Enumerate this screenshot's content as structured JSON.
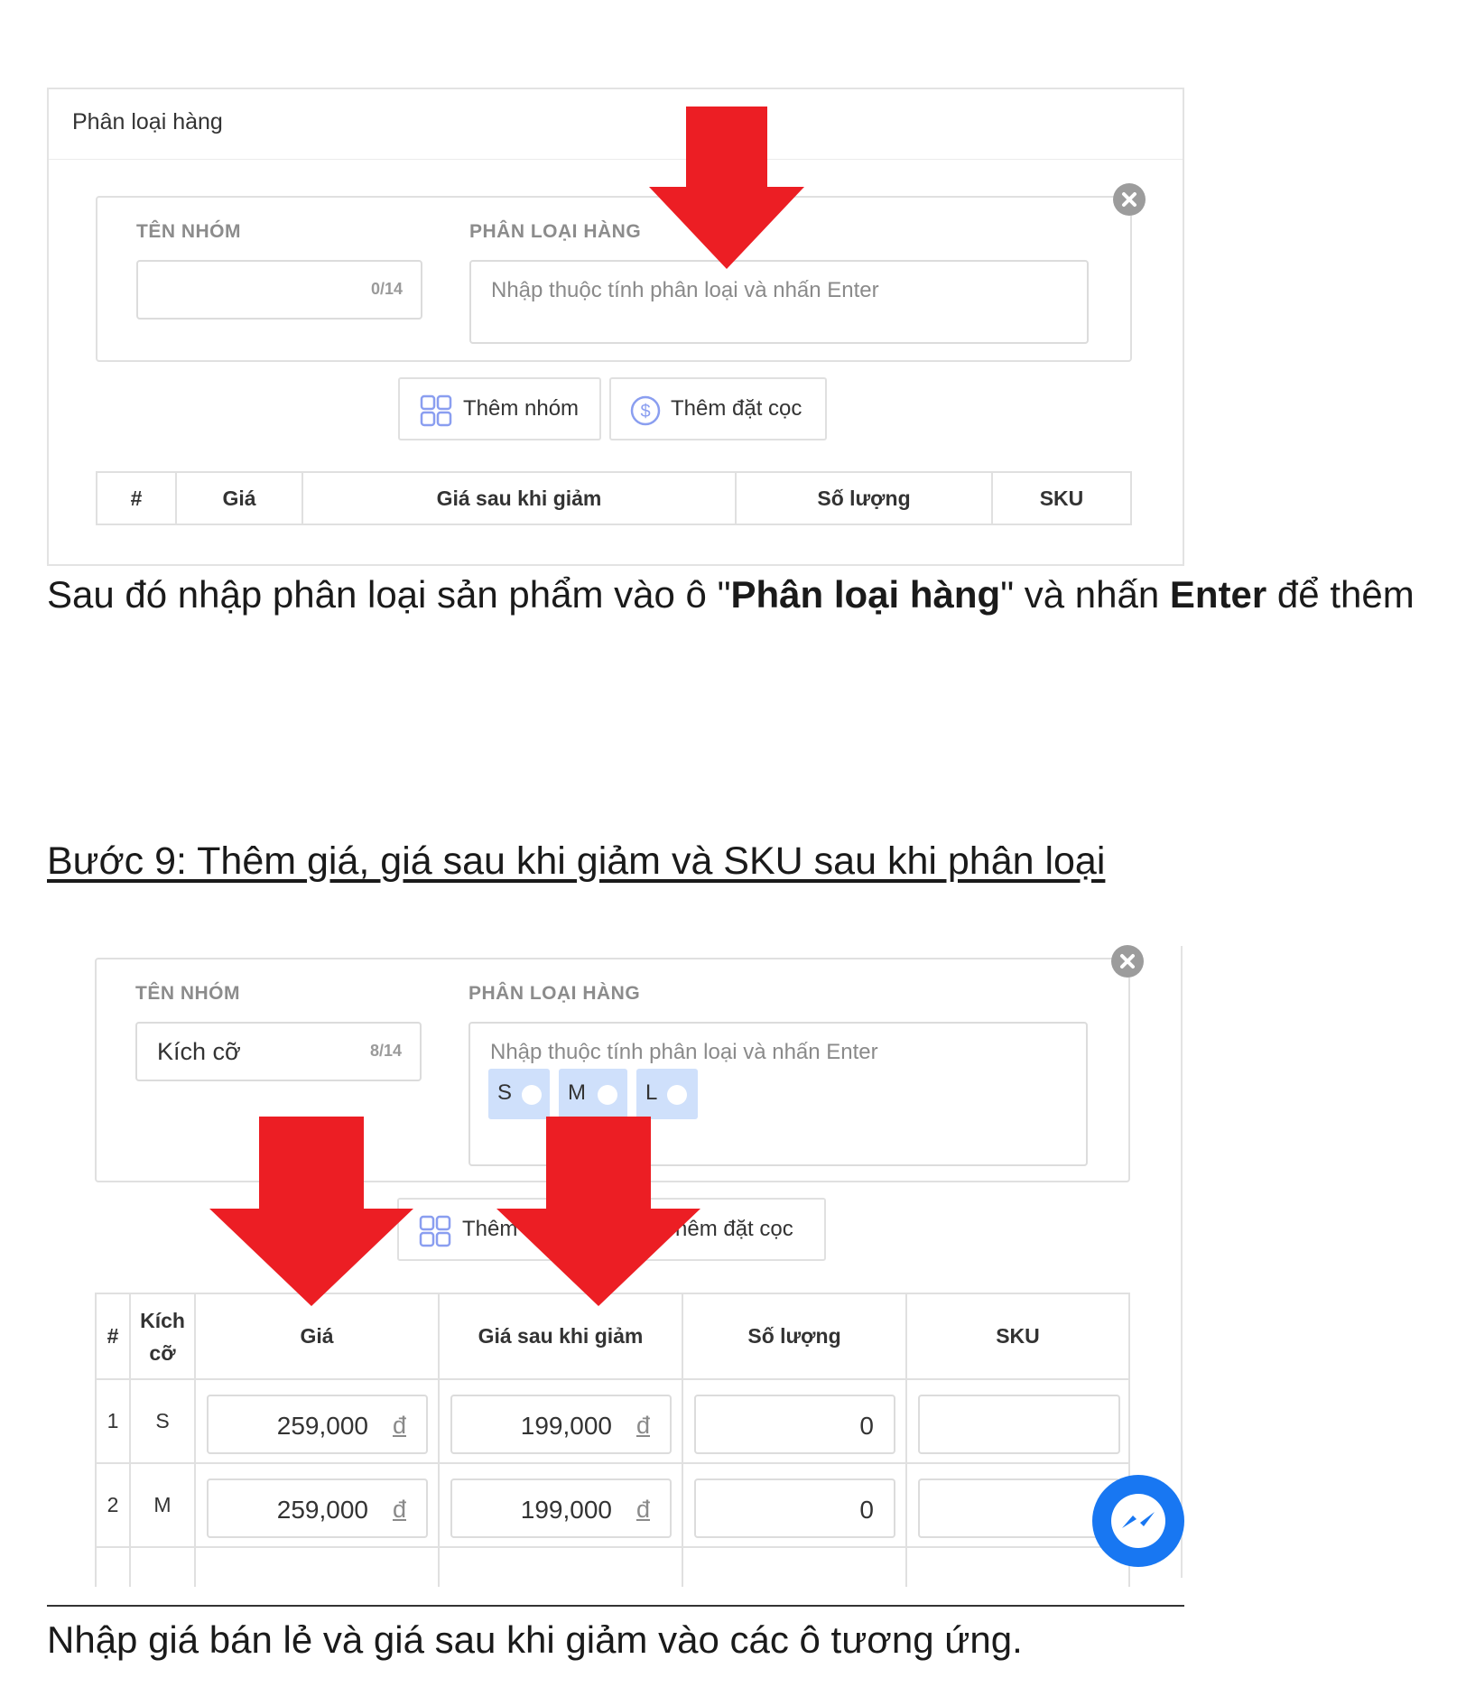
{
  "panel1": {
    "title": "Phân loại hàng",
    "group_name_label": "TÊN NHÓM",
    "group_counter": "0/14",
    "variation_label": "PHÂN LOẠI HÀNG",
    "variation_placeholder": "Nhập thuộc tính phân loại và nhấn Enter",
    "add_group_label": "Thêm nhóm",
    "add_deposit_label": "Thêm đặt cọc",
    "columns": [
      "#",
      "Giá",
      "Giá sau khi giảm",
      "Số lượng",
      "SKU"
    ]
  },
  "caption1": {
    "part1": "Sau đó nhập phân loại sản phẩm vào ô \"",
    "bold1": "Phân loại hàng",
    "part2": "\" và nhấn ",
    "bold2": "Enter",
    "part3": " để thêm"
  },
  "step_heading": "Bước 9: Thêm giá, giá sau khi giảm và SKU sau khi phân loại",
  "panel2": {
    "group_name_label": "TÊN NHÓM",
    "group_name_value": "Kích cỡ",
    "group_counter": "8/14",
    "variation_label": "PHÂN LOẠI HÀNG",
    "variation_placeholder": "Nhập thuộc tính phân loại và nhấn Enter",
    "tags": [
      "S",
      "M",
      "L"
    ],
    "add_group_label": "Thêm",
    "add_deposit_label": "hêm đặt cọc",
    "columns": [
      "#",
      "Kích cỡ",
      "Giá",
      "Giá sau khi giảm",
      "Số lượng",
      "SKU"
    ],
    "currency": "đ",
    "rows": [
      {
        "index": "1",
        "size": "S",
        "price": "259,000",
        "sale_price": "199,000",
        "quantity": "0",
        "sku": ""
      },
      {
        "index": "2",
        "size": "M",
        "price": "259,000",
        "sale_price": "199,000",
        "quantity": "0",
        "sku": ""
      }
    ]
  },
  "caption2": "Nhập giá bán lẻ và giá sau khi giảm vào các ô tương ứng.",
  "colors": {
    "arrow": "#ec1e24",
    "tag_bg": "#cfe0fb",
    "messenger": "#1877f2",
    "border": "#e0e0e0"
  },
  "icons": [
    "close-icon",
    "grid-icon",
    "dollar-circle-icon",
    "messenger-icon"
  ]
}
